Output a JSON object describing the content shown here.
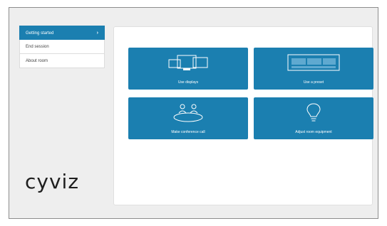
{
  "sidebar": {
    "items": [
      {
        "label": "Getting started",
        "active": true
      },
      {
        "label": "End session",
        "active": false
      },
      {
        "label": "About room",
        "active": false
      }
    ],
    "chevron": "›"
  },
  "logo": {
    "text": "cyviz"
  },
  "tiles": [
    {
      "label": "Use displays",
      "icon": "displays-icon"
    },
    {
      "label": "Use a preset",
      "icon": "preset-layout-icon"
    },
    {
      "label": "Make conference call",
      "icon": "conference-call-icon"
    },
    {
      "label": "Adjust room equipment",
      "icon": "lightbulb-icon"
    }
  ],
  "colors": {
    "accent": "#1b7fb0",
    "background": "#eeeeee",
    "panel": "#ffffff"
  }
}
